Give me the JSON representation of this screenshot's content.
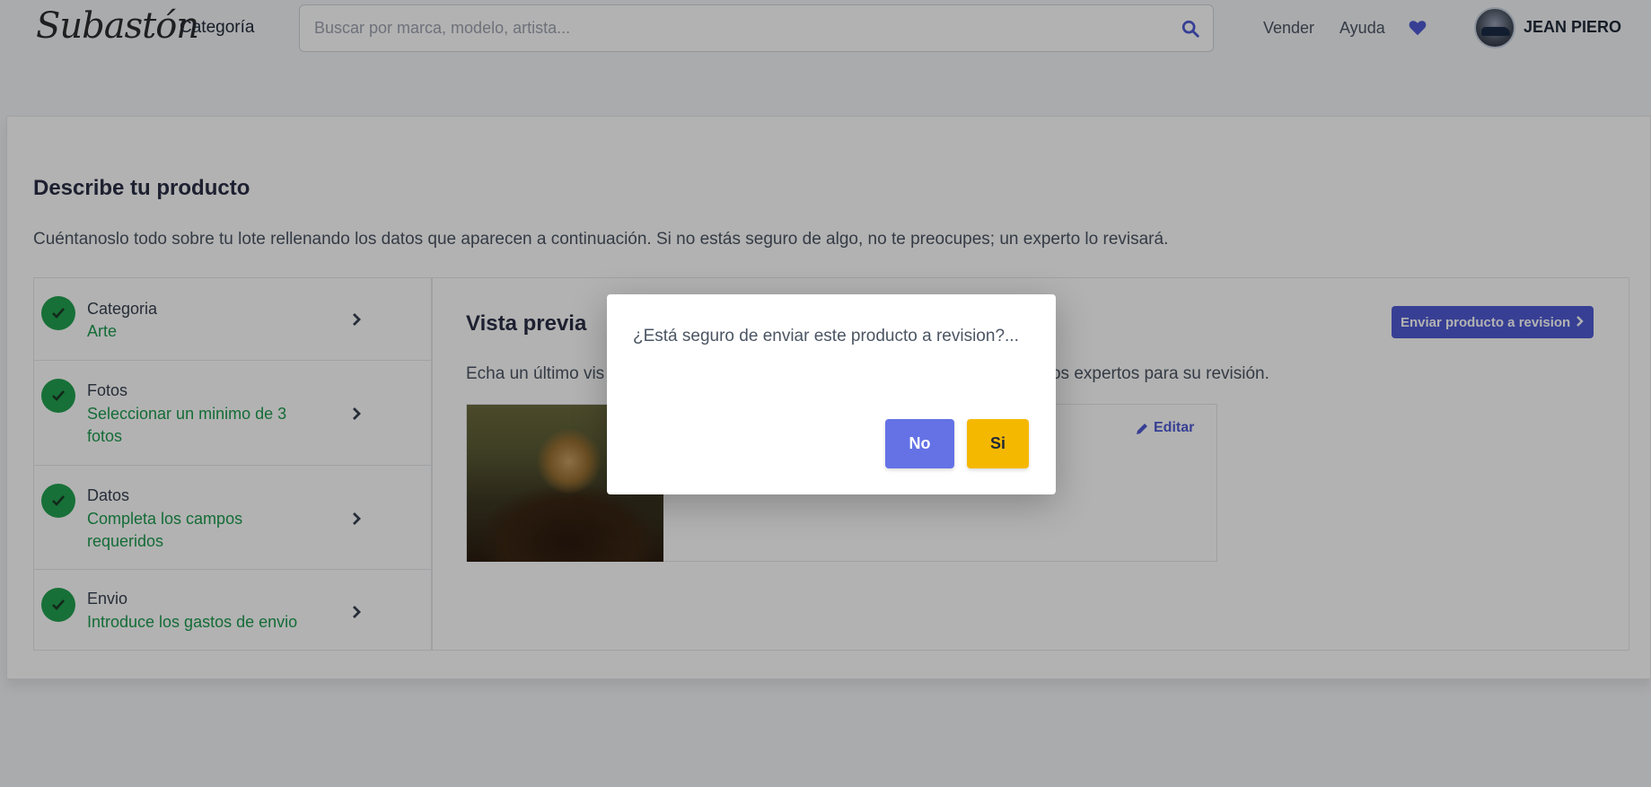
{
  "header": {
    "logo": "Subastón",
    "categoria": "Categoría",
    "search_placeholder": "Buscar por marca, modelo, artista...",
    "vender": "Vender",
    "ayuda": "Ayuda",
    "username": "JEAN PIERO"
  },
  "main": {
    "title": "Describe tu producto",
    "subtitle": "Cuéntanoslo todo sobre tu lote rellenando los datos que aparecen a continuación. Si no estás seguro de algo, no te preocupes; un experto lo revisará."
  },
  "steps": [
    {
      "label": "Categoria",
      "desc": "Arte"
    },
    {
      "label": "Fotos",
      "desc": "Seleccionar un minimo de 3 fotos"
    },
    {
      "label": "Datos",
      "desc": "Completa los campos requeridos"
    },
    {
      "label": "Envio",
      "desc": "Introduce los gastos de envio"
    }
  ],
  "preview": {
    "title": "Vista previa",
    "text_start": "Echa un último vis",
    "text_end": "nuestros expertos para su revisión.",
    "send_button": "Enviar producto a revision",
    "edit_link": "Editar"
  },
  "modal": {
    "message": "¿Está seguro de enviar este producto a revision?...",
    "no_label": "No",
    "si_label": "Si"
  },
  "colors": {
    "accent": "#4f5bd5",
    "success": "#22a150",
    "warning": "#f5b800"
  }
}
